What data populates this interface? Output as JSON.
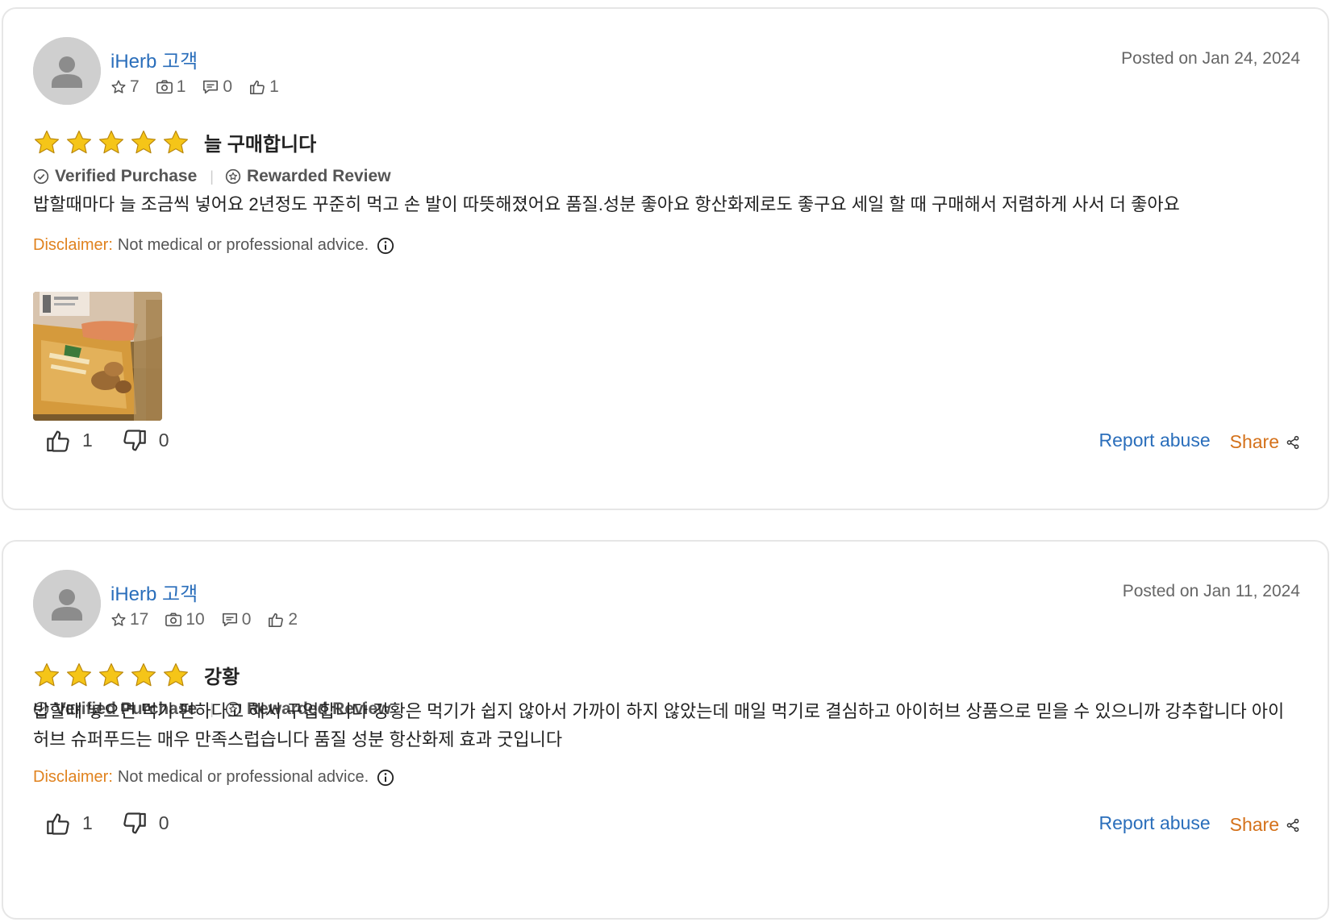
{
  "reviews": [
    {
      "author": "iHerb 고객",
      "stats": {
        "stars": "7",
        "photos": "1",
        "comments": "0",
        "likes": "1"
      },
      "posted": "Posted on Jan 24, 2024",
      "rating": 5,
      "title": "늘 구매합니다",
      "badges": {
        "verified": "Verified Purchase",
        "rewarded": "Rewarded Review"
      },
      "text": "밥할때마다 늘 조금씩 넣어요 2년정도 꾸준히 먹고 손 발이 따뜻해졌어요 품질.성분 좋아요 항산화제로도 좋구요 세일 할 때 구매해서 저렴하게 사서 더 좋아요",
      "disclaimer": {
        "label": "Disclaimer:",
        "text": "Not medical or professional advice."
      },
      "helpful": "1",
      "unhelpful": "0",
      "report_label": "Report abuse",
      "share_label": "Share"
    },
    {
      "author": "iHerb 고객",
      "stats": {
        "stars": "17",
        "photos": "10",
        "comments": "0",
        "likes": "2"
      },
      "posted": "Posted on Jan 11, 2024",
      "rating": 5,
      "title": "강황",
      "badges": {
        "verified": "Verified Purchase",
        "rewarded": "Rewarded Review"
      },
      "text": "밥할때 넣으면 먹기 편하다고 해서 구입합니다 강황은 먹기가 쉽지 않아서 가까이 하지 않았는데 매일 먹기로 결심하고 아이허브 상품으로 믿을 수 있으니까 강추합니다 아이허브 슈퍼푸드는 매우 만족스럽습니다 품질 성분 항산화제 효과 굿입니다",
      "disclaimer": {
        "label": "Disclaimer:",
        "text": "Not medical or professional advice."
      },
      "helpful": "1",
      "unhelpful": "0",
      "report_label": "Report abuse",
      "share_label": "Share"
    }
  ],
  "colors": {
    "link": "#2a6ebb",
    "accent": "#d4711a",
    "disclaimer": "#e0821e",
    "star": "#f5c518"
  }
}
